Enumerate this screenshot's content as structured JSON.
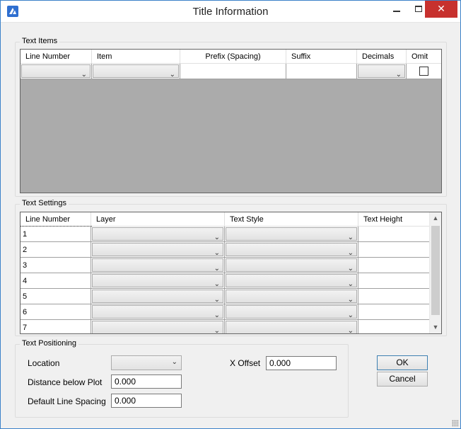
{
  "window": {
    "title": "Title Information",
    "close_symbol": "✕"
  },
  "text_items": {
    "group_label": "Text Items",
    "columns": [
      "Line Number",
      "Item",
      "Prefix (Spacing)",
      "Suffix",
      "Decimals",
      "Omit"
    ],
    "row": {
      "omit_checked": false
    }
  },
  "text_settings": {
    "group_label": "Text Settings",
    "columns": [
      "Line Number",
      "Layer",
      "Text Style",
      "Text Height"
    ],
    "rows": [
      {
        "line": "1"
      },
      {
        "line": "2"
      },
      {
        "line": "3"
      },
      {
        "line": "4"
      },
      {
        "line": "5"
      },
      {
        "line": "6"
      },
      {
        "line": "7"
      }
    ],
    "selected_row": "1"
  },
  "text_positioning": {
    "group_label": "Text Positioning",
    "location_label": "Location",
    "location_value": "",
    "distance_label": "Distance below Plot",
    "distance_value": "0.000",
    "line_spacing_label": "Default Line Spacing",
    "line_spacing_value": "0.000",
    "x_offset_label": "X Offset",
    "x_offset_value": "0.000"
  },
  "buttons": {
    "ok": "OK",
    "cancel": "Cancel"
  },
  "icons": {
    "app": "bricscad-logo-icon",
    "dropdown": "chevron-down-icon",
    "scroll_up": "scroll-up-arrow-icon",
    "scroll_down": "scroll-down-arrow-icon"
  },
  "colors": {
    "accent": "#3c82c9",
    "close_button": "#c7312e",
    "grid_background": "#ababab"
  }
}
